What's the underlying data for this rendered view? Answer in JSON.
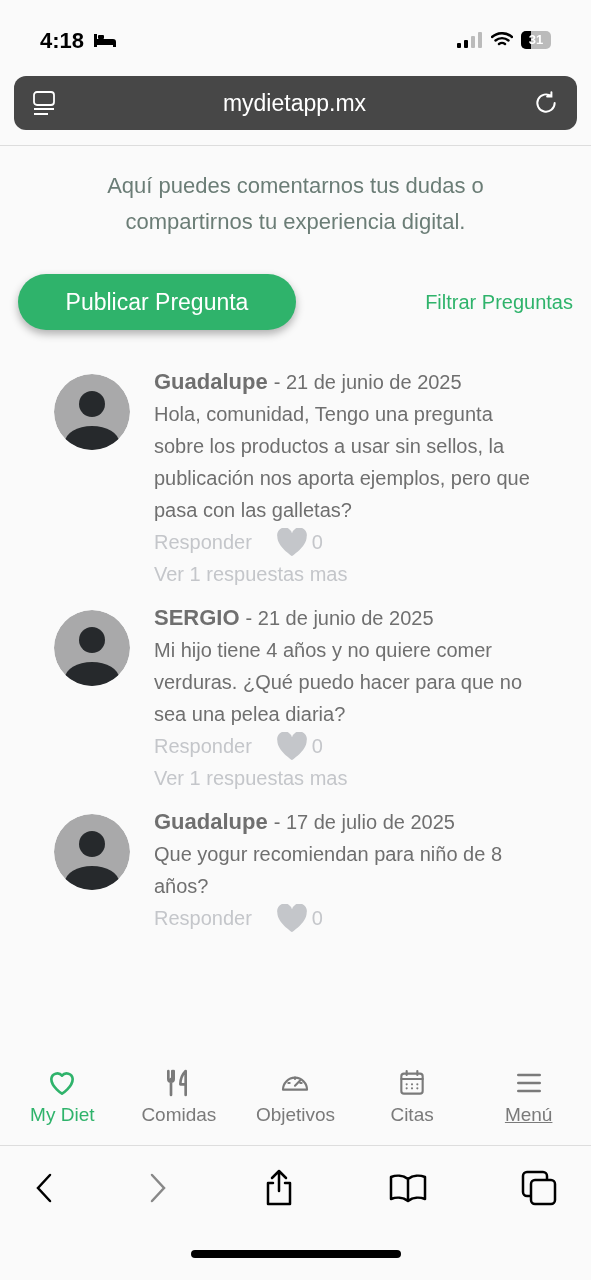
{
  "status_bar": {
    "time": "4:18",
    "battery": "31"
  },
  "url_bar": {
    "url": "mydietapp.mx"
  },
  "intro": "Aquí puedes comentarnos tus dudas o compartirnos tu experiencia digital.",
  "actions": {
    "publish": "Publicar Pregunta",
    "filter": "Filtrar Preguntas"
  },
  "posts": [
    {
      "author": "Guadalupe",
      "date": "- 21 de junio de 2025",
      "body": "Hola, comunidad, Tengo una pregunta sobre los productos a usar sin sellos, la publicación nos aporta ejemplos, pero que pasa con las galletas?",
      "reply": "Responder",
      "likes": "0",
      "liked": false,
      "more": "Ver 1 respuestas mas"
    },
    {
      "author": "SERGIO",
      "date": "- 21 de junio de 2025",
      "body": "Mi hijo tiene 4 años y no quiere comer verduras. ¿Qué puedo hacer para que no sea una pelea diaria?",
      "reply": "Responder",
      "likes": "0",
      "liked": false,
      "more": "Ver 1 respuestas mas"
    },
    {
      "author": "Guadalupe",
      "date": "- 17 de julio de 2025",
      "body": "Que yogur recomiendan para niño de 8 años?",
      "reply": "Responder",
      "likes": "0",
      "liked": false
    }
  ],
  "bottom_nav": [
    {
      "kind": "heart",
      "label": "My Diet",
      "selected": true
    },
    {
      "kind": "cutlery",
      "label": "Comidas",
      "selected": false
    },
    {
      "kind": "gauge",
      "label": "Objetivos",
      "selected": false
    },
    {
      "kind": "calendar",
      "label": "Citas",
      "selected": false
    },
    {
      "kind": "menu",
      "label": "Menú",
      "selected": false
    }
  ],
  "browser_toolbar": {
    "forward_disabled": true
  }
}
